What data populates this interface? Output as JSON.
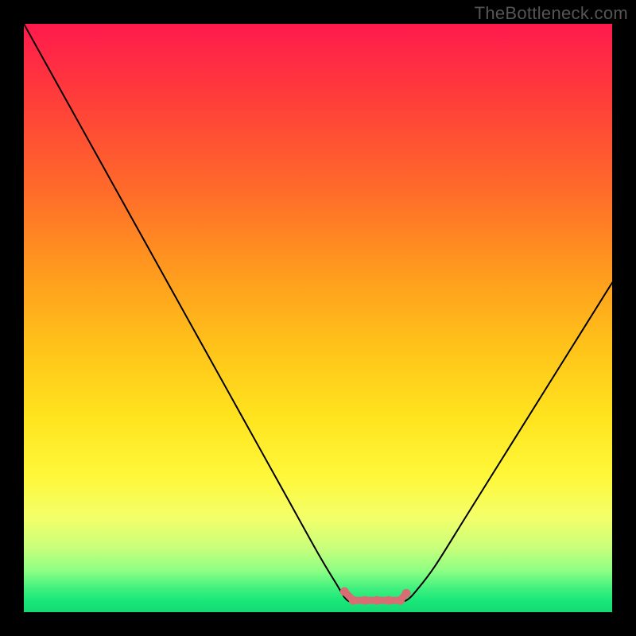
{
  "watermark": {
    "text": "TheBottleneck.com"
  },
  "chart_data": {
    "type": "line",
    "title": "",
    "xlabel": "",
    "ylabel": "",
    "xlim": [
      0,
      100
    ],
    "ylim": [
      0,
      100
    ],
    "plateau_pct": {
      "start": 55,
      "end": 65,
      "value_pct": 2
    },
    "series": [
      {
        "name": "bottleneck-curve",
        "x": [
          0,
          5,
          10,
          15,
          20,
          25,
          30,
          35,
          40,
          45,
          50,
          53,
          55,
          57,
          60,
          63,
          65,
          67,
          70,
          75,
          80,
          85,
          90,
          95,
          100
        ],
        "y": [
          100,
          91,
          82,
          73,
          64,
          55,
          46,
          37,
          28,
          19,
          10,
          5,
          2,
          2,
          2,
          2,
          2,
          4,
          8,
          16,
          24,
          32,
          40,
          48,
          56
        ]
      }
    ],
    "highlight": {
      "color": "#d96d74",
      "points_pct": [
        {
          "x": 54.5,
          "y": 3.5
        },
        {
          "x": 56.0,
          "y": 2.0
        },
        {
          "x": 58.0,
          "y": 2.0
        },
        {
          "x": 60.0,
          "y": 2.0
        },
        {
          "x": 62.0,
          "y": 2.0
        },
        {
          "x": 64.0,
          "y": 2.0
        },
        {
          "x": 65.0,
          "y": 3.2
        }
      ]
    },
    "gradient_stops": [
      {
        "pct": 0,
        "color": "#ff1a4d"
      },
      {
        "pct": 12,
        "color": "#ff3b3b"
      },
      {
        "pct": 28,
        "color": "#ff6a2a"
      },
      {
        "pct": 42,
        "color": "#ff9a1e"
      },
      {
        "pct": 55,
        "color": "#ffc31a"
      },
      {
        "pct": 67,
        "color": "#ffe41f"
      },
      {
        "pct": 77,
        "color": "#fff83a"
      },
      {
        "pct": 84,
        "color": "#f3ff6a"
      },
      {
        "pct": 89,
        "color": "#c9ff7a"
      },
      {
        "pct": 93,
        "color": "#8cff84"
      },
      {
        "pct": 96,
        "color": "#40f07f"
      },
      {
        "pct": 98,
        "color": "#19e879"
      },
      {
        "pct": 100,
        "color": "#14d973"
      }
    ]
  }
}
